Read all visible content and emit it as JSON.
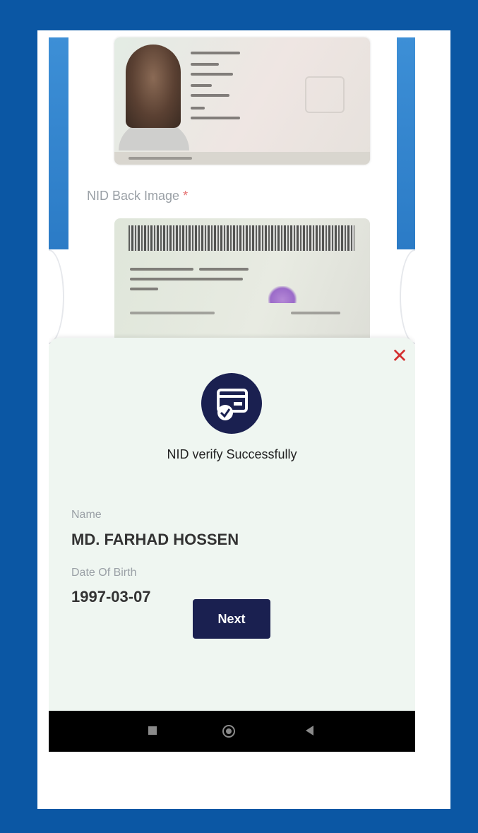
{
  "background_app": {
    "nid_back_label": "NID Back Image",
    "required_mark": "*"
  },
  "modal": {
    "title": "NID verify Successfully",
    "name_label": "Name",
    "name_value": "MD. FARHAD HOSSEN",
    "dob_label": "Date Of Birth",
    "dob_value": "1997-03-07",
    "next_label": "Next",
    "close_glyph": "✕"
  },
  "colors": {
    "frame_blue": "#0b57a4",
    "modal_bg": "#eff6f1",
    "primary_navy": "#1a2050",
    "close_red": "#d32f2f"
  },
  "icons": {
    "verified_card": "id-card-check-icon",
    "close": "close-icon",
    "recents": "square-icon",
    "home": "circle-icon",
    "back": "triangle-back-icon"
  }
}
